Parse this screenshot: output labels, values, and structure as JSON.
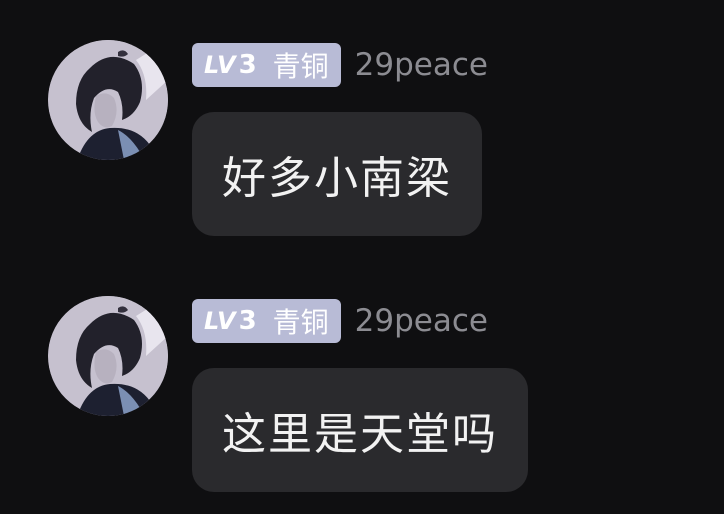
{
  "messages": [
    {
      "user": {
        "level_prefix": "LV",
        "level_number": "3",
        "rank": "青铜",
        "name": "29peace"
      },
      "text": "好多小南梁"
    },
    {
      "user": {
        "level_prefix": "LV",
        "level_number": "3",
        "rank": "青铜",
        "name": "29peace"
      },
      "text": "这里是天堂吗"
    }
  ],
  "colors": {
    "background": "#0f0f11",
    "bubble": "#2a2a2d",
    "badge": "#b8bbd6",
    "username": "#8c8c92",
    "message_text": "#f2f2f2"
  },
  "icons": {
    "avatar": "user-avatar-illustration"
  }
}
